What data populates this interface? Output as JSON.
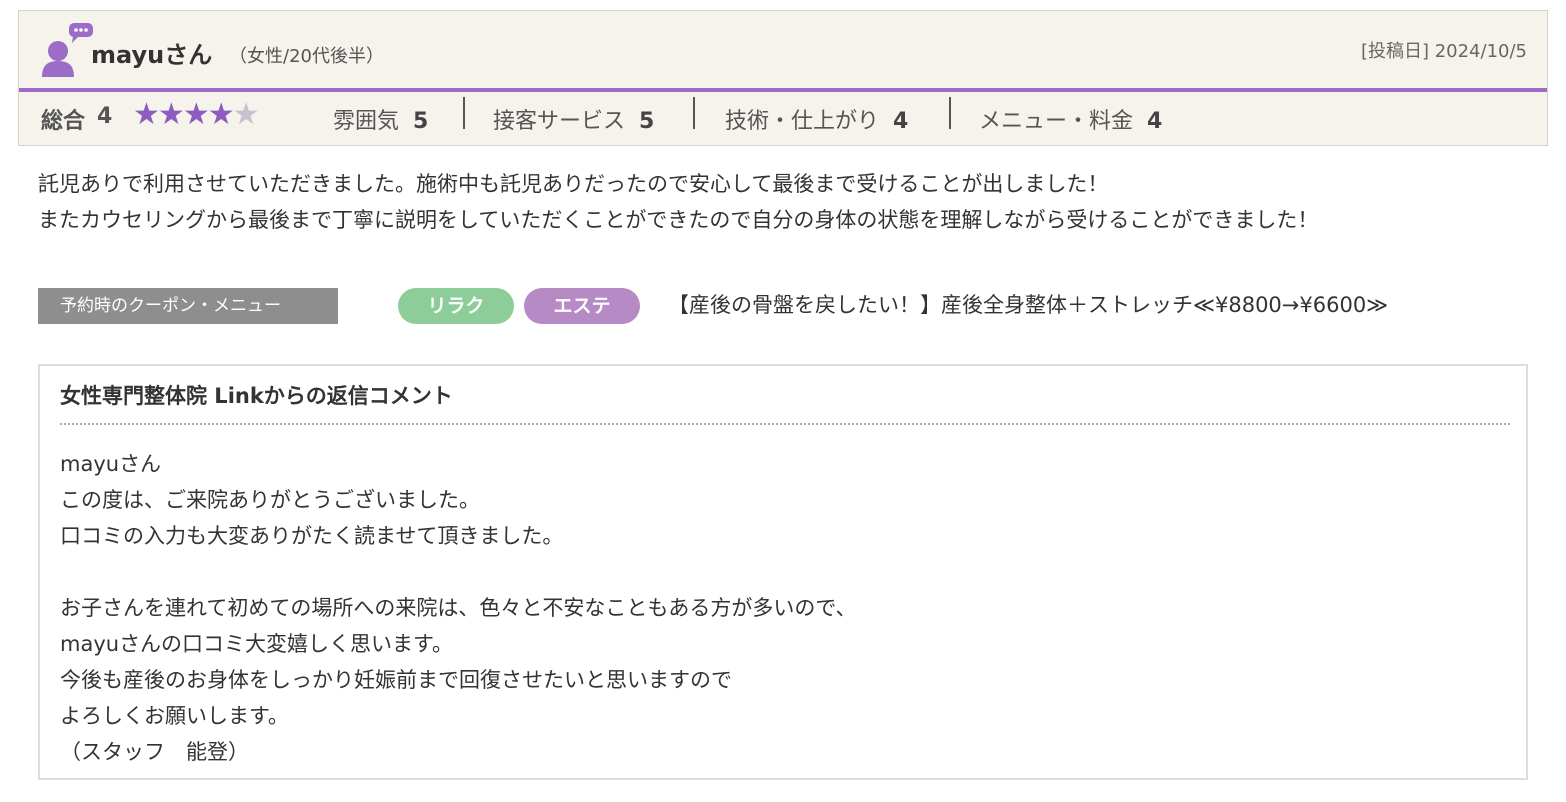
{
  "review": {
    "reviewer_name": "mayuさん",
    "reviewer_attributes": "（女性/20代後半）",
    "post_date": "[投稿日] 2024/10/5",
    "overall_label": "総合",
    "overall_score": "4",
    "overall_stars": 4,
    "stars_max": 5,
    "ratings": [
      {
        "label": "雰囲気",
        "score": "5"
      },
      {
        "label": "接客サービス",
        "score": "5"
      },
      {
        "label": "技術・仕上がり",
        "score": "4"
      },
      {
        "label": "メニュー・料金",
        "score": "4"
      }
    ],
    "body_lines": [
      "託児ありで利用させていただきました。施術中も託児ありだったので安心して最後まで受けることが出しました！",
      "またカウセリングから最後まで丁寧に説明をしていただくことができたので自分の身体の状態を理解しながら受けることができました！"
    ]
  },
  "coupon": {
    "label": "予約時のクーポン・メニュー",
    "tags": [
      "リラク",
      "エステ"
    ],
    "text": "【産後の骨盤を戻したい！】産後全身整体＋ストレッチ≪¥8800→¥6600≫"
  },
  "reply": {
    "title": "女性専門整体院 Linkからの返信コメント",
    "lines": [
      "mayuさん",
      "この度は、ご来院ありがとうございました。",
      "口コミの入力も大変ありがたく読ませて頂きました。",
      "",
      "お子さんを連れて初めての場所への来院は、色々と不安なこともある方が多いので、",
      "mayuさんの口コミ大変嬉しく思います。",
      "今後も産後のお身体をしっかり妊娠前まで回復させたいと思いますので",
      "よろしくお願いします。",
      "（スタッフ　能登）"
    ]
  },
  "colors": {
    "accent_purple": "#9b6cc8",
    "tag_relax": "#8ccd99",
    "tag_esthe": "#b58ac5",
    "header_bg": "#f6f3ec"
  },
  "icons": {
    "avatar": "user-comment-icon",
    "star": "star-icon"
  }
}
